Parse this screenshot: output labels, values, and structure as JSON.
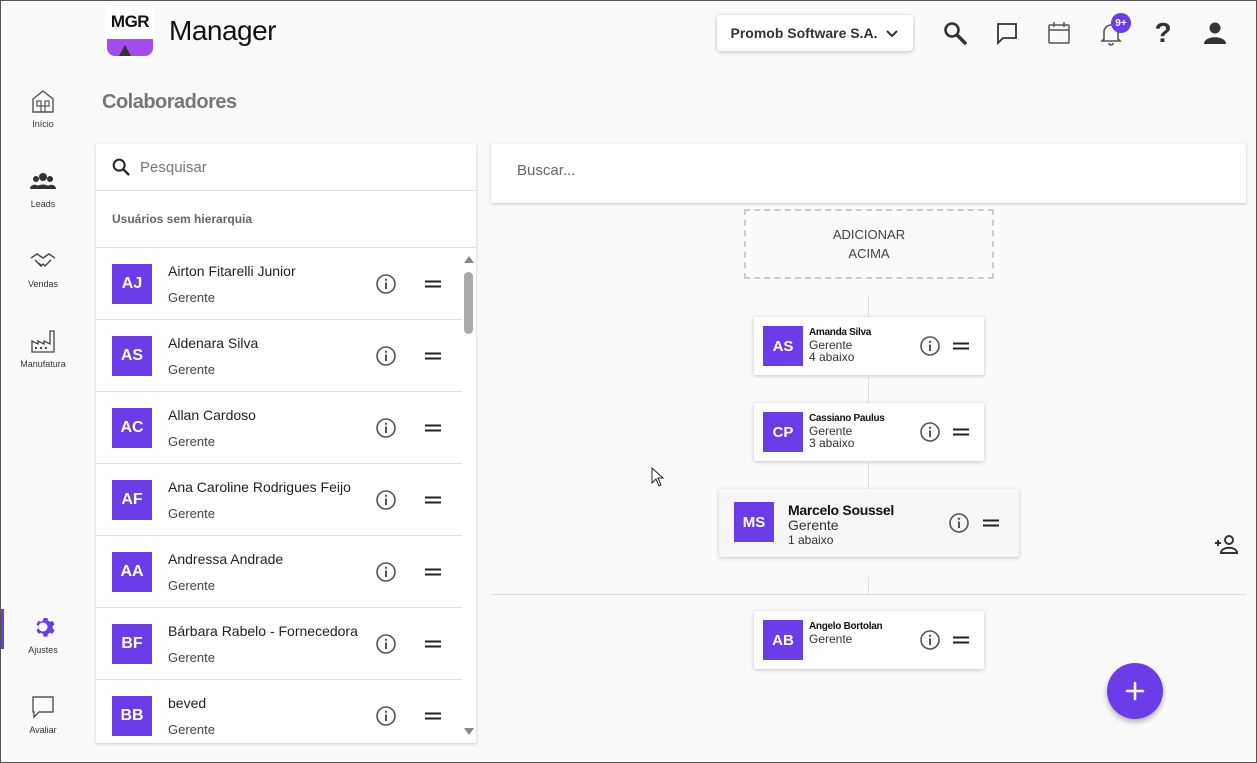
{
  "app": {
    "logo_text": "MGR",
    "title": "Manager"
  },
  "header": {
    "company": "Promob Software S.A.",
    "notifications_badge": "9+",
    "help_label": "?"
  },
  "sidebar": {
    "items": [
      {
        "label": "Início",
        "icon": "home-icon"
      },
      {
        "label": "Leads",
        "icon": "people-icon"
      },
      {
        "label": "Vendas",
        "icon": "handshake-icon"
      },
      {
        "label": "Manufatura",
        "icon": "factory-icon"
      },
      {
        "label": "Ajustes",
        "icon": "gear-icon",
        "active": true
      },
      {
        "label": "Avaliar",
        "icon": "chat-icon"
      }
    ]
  },
  "page": {
    "title": "Colaboradores"
  },
  "left_panel": {
    "search_placeholder": "Pesquisar",
    "section_label": "Usuários sem hierarquia",
    "users": [
      {
        "initials": "AJ",
        "name": "Airton Fitarelli Junior",
        "role": "Gerente"
      },
      {
        "initials": "AS",
        "name": "Aldenara Silva",
        "role": "Gerente"
      },
      {
        "initials": "AC",
        "name": "Allan Cardoso",
        "role": "Gerente"
      },
      {
        "initials": "AF",
        "name": "Ana Caroline Rodrigues Feijo",
        "role": "Gerente"
      },
      {
        "initials": "AA",
        "name": "Andressa Andrade",
        "role": "Gerente"
      },
      {
        "initials": "BF",
        "name": "Bárbara Rabelo - Fornecedora",
        "role": "Gerente"
      },
      {
        "initials": "BB",
        "name": "beved",
        "role": "Gerente"
      }
    ]
  },
  "hierarchy": {
    "search_placeholder": "Buscar...",
    "add_above_line1": "ADICIONAR",
    "add_above_line2": "ACIMA",
    "nodes": [
      {
        "initials": "AS",
        "name": "Amanda Silva",
        "role": "Gerente",
        "below": "4 abaixo"
      },
      {
        "initials": "CP",
        "name": "Cassiano Paulus",
        "role": "Gerente",
        "below": "3 abaixo"
      },
      {
        "initials": "MS",
        "name": "Marcelo Soussel",
        "role": "Gerente",
        "below": "1 abaixo"
      },
      {
        "initials": "AB",
        "name": "Angelo Bortolan",
        "role": "Gerente",
        "below": ""
      }
    ]
  },
  "colors": {
    "accent": "#6a3de8",
    "logo_purple": "#a44cf0"
  }
}
